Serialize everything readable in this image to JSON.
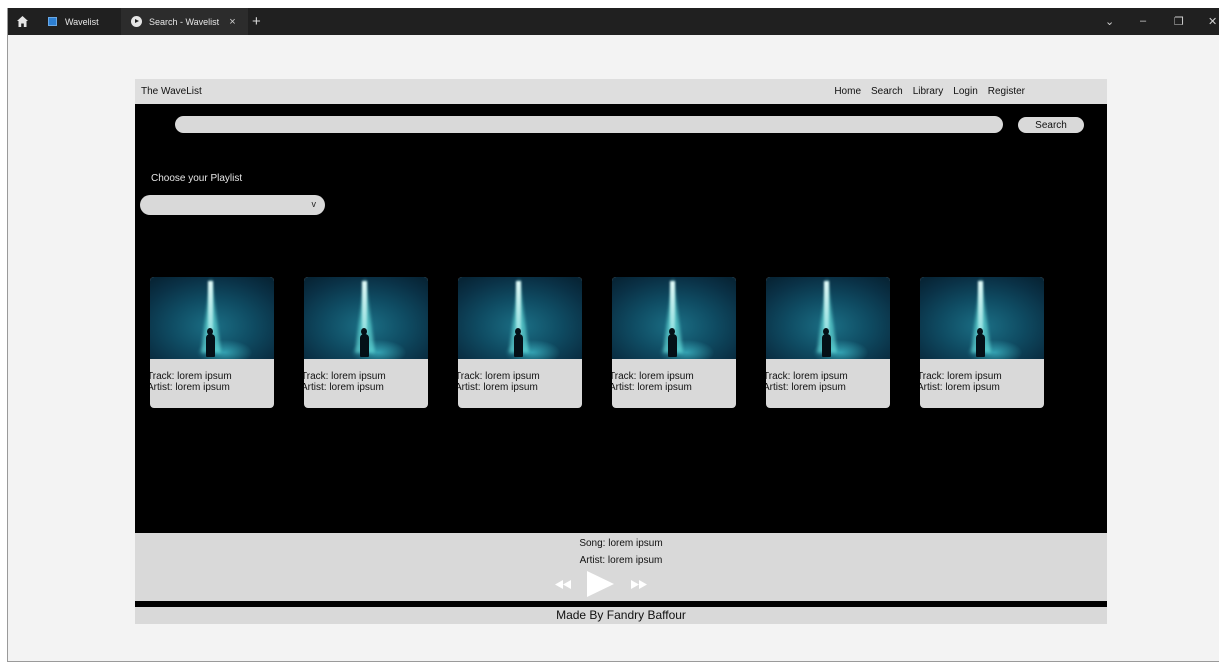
{
  "browser": {
    "tabs": [
      {
        "title": "Wavelist",
        "active": false
      },
      {
        "title": "Search - Wavelist",
        "active": true
      }
    ],
    "close_glyph": "×",
    "new_tab_glyph": "+",
    "window_controls": [
      "⌄",
      "–",
      "❐",
      "✕"
    ]
  },
  "navbar": {
    "brand": "The WaveList",
    "links": [
      "Home",
      "Search",
      "Library",
      "Login",
      "Register"
    ]
  },
  "search": {
    "value": "",
    "button_label": "Search"
  },
  "playlist": {
    "label": "Choose your Playlist",
    "selected": "",
    "chevron": "v"
  },
  "cards": [
    {
      "track": "Track: lorem ipsum",
      "artist": "Artist: lorem ipsum"
    },
    {
      "track": "Track: lorem ipsum",
      "artist": "Artist: lorem ipsum"
    },
    {
      "track": "Track: lorem ipsum",
      "artist": "Artist: lorem ipsum"
    },
    {
      "track": "Track: lorem ipsum",
      "artist": "Artist: lorem ipsum"
    },
    {
      "track": "Track: lorem ipsum",
      "artist": "Artist: lorem ipsum"
    },
    {
      "track": "Track: lorem ipsum",
      "artist": "Artist: lorem ipsum"
    }
  ],
  "player": {
    "song": "Song: lorem ipsum",
    "artist": "Artist: lorem ipsum",
    "controls": [
      "rewind-icon",
      "play-icon",
      "fast-forward-icon"
    ]
  },
  "footer": {
    "text": "Made By Fandry Baffour"
  },
  "colors": {
    "page_bg": "#000000",
    "panel_gray": "#d9d9d9",
    "navbar_gray": "#dedede",
    "tabbar": "#202020",
    "controls_white": "#ffffff"
  }
}
